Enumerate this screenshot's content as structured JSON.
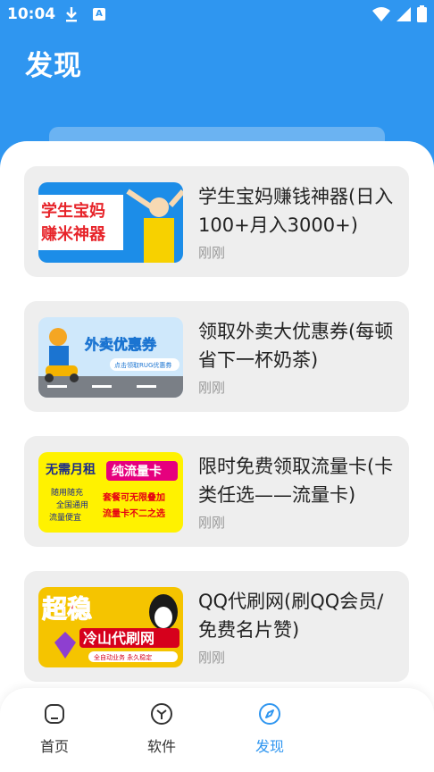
{
  "status_bar": {
    "time": "10:04"
  },
  "header": {
    "title": "发现"
  },
  "cards": [
    {
      "title": "学生宝妈赚钱神器(日入100+月入3000+)",
      "time": "刚刚",
      "thumb_text_1": "学生宝妈",
      "thumb_text_2": "赚米神器"
    },
    {
      "title": "领取外卖大优惠券(每顿省下一杯奶茶)",
      "time": "刚刚",
      "thumb_text_1": "外卖优惠券",
      "thumb_text_2": "点击领取RUG优惠券"
    },
    {
      "title": "限时免费领取流量卡(卡类任选——流量卡)",
      "time": "刚刚",
      "thumb_text_1": "无需月租",
      "thumb_text_2": "纯流量卡",
      "thumb_text_3": "随用随充",
      "thumb_text_4": "全国通用",
      "thumb_text_5": "流量便宜",
      "thumb_text_6": "套餐可无限叠加",
      "thumb_text_7": "流量卡不二之选"
    },
    {
      "title": "QQ代刷网(刷QQ会员/免费名片赞)",
      "time": "刚刚",
      "thumb_text_1": "超稳",
      "thumb_text_2": "冷山代刷网",
      "thumb_text_3": "全自动业务 永久稳定"
    }
  ],
  "tabbar": {
    "items": [
      {
        "label": "首页",
        "icon": "home-icon"
      },
      {
        "label": "软件",
        "icon": "cube-icon"
      },
      {
        "label": "发现",
        "icon": "compass-icon"
      }
    ]
  },
  "colors": {
    "primary": "#2f96f0",
    "card_bg": "#eeeeee",
    "muted": "#999999"
  }
}
